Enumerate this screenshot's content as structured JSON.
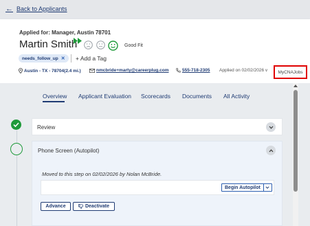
{
  "nav": {
    "back_label": "Back to Applicants"
  },
  "applicant": {
    "applied_for": "Applied for: Manager, Austin 78701",
    "name": "Martin Smith",
    "fit_label": "Good Fit",
    "tag": "needs_follow_up",
    "add_tag": "+ Add a Tag",
    "location": "Austin - TX - 78704(2.4 mi.)",
    "email": "nmcbride+marty@careerplug.com",
    "phone": "555-718-2305",
    "applied_on": "Applied on 02/02/2026 v",
    "source": "MyCNAJobs"
  },
  "tabs": [
    {
      "label": "Overview"
    },
    {
      "label": "Applicant Evaluation"
    },
    {
      "label": "Scorecards"
    },
    {
      "label": "Documents"
    },
    {
      "label": "All Activity"
    }
  ],
  "steps": {
    "review": {
      "label": "Review"
    },
    "phone_screen": {
      "label": "Phone Screen (Autopilot)",
      "moved_text": "Moved to this step on 02/02/2026 by Nolan McBride.",
      "begin_label": "Begin Autopilot",
      "advance_label": "Advance",
      "deactivate_label": "Deactivate"
    }
  },
  "colors": {
    "accent": "#1f3b73",
    "success": "#1f9a3a",
    "highlight": "#e00000"
  },
  "icons": [
    "back-arrow-icon",
    "fast-forward-icon",
    "sad-face-icon",
    "neutral-face-icon",
    "happy-face-icon",
    "location-pin-icon",
    "envelope-icon",
    "phone-icon",
    "check-icon",
    "chevron-down-icon",
    "chevron-up-icon",
    "thumbs-down-icon"
  ]
}
